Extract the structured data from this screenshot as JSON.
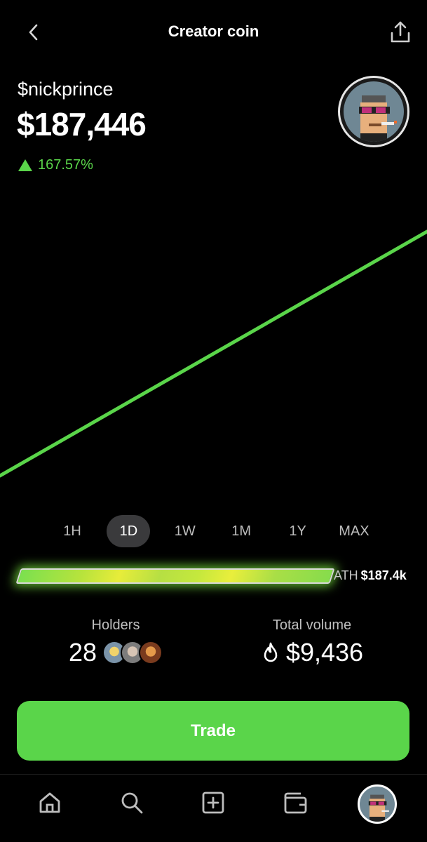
{
  "header": {
    "title": "Creator coin",
    "back_icon": "chevron-left-icon",
    "share_icon": "share-icon"
  },
  "coin": {
    "ticker": "$nickprince",
    "price": "$187,446",
    "change": "167.57%",
    "change_direction": "up",
    "change_color": "#5ad54a"
  },
  "chart_data": {
    "type": "line",
    "color": "#5ad54a",
    "trend": "rising",
    "series": [
      {
        "values": [
          0,
          1
        ]
      }
    ]
  },
  "ranges": [
    "1H",
    "1D",
    "1W",
    "1M",
    "1Y",
    "MAX"
  ],
  "active_range": "1D",
  "ath": {
    "label": "ATH",
    "value": "$187.4k",
    "progress": 1.0
  },
  "stats": {
    "holders_label": "Holders",
    "holders_value": "28",
    "volume_label": "Total volume",
    "volume_value": "$9,436",
    "volume_icon": "flame-icon"
  },
  "trade": {
    "label": "Trade"
  },
  "accent": "#5ad54a",
  "tabbar": {
    "icons": [
      "home-icon",
      "search-icon",
      "create-icon",
      "wallet-icon",
      "profile-avatar"
    ]
  }
}
